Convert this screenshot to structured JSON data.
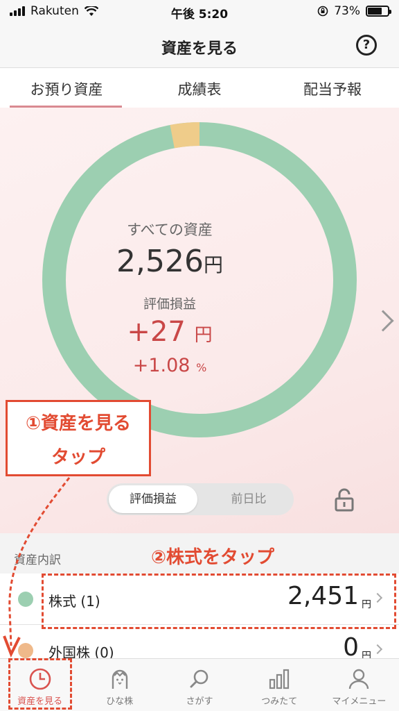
{
  "status_bar": {
    "carrier": "Rakuten",
    "time": "午後 5:20",
    "battery": "73%",
    "battery_level": 0.73
  },
  "nav": {
    "title": "資産を見る",
    "help_icon": "?"
  },
  "tabs": [
    {
      "label": "お預り資産",
      "active": true
    },
    {
      "label": "成績表",
      "active": false
    },
    {
      "label": "配当予報",
      "active": false
    }
  ],
  "summary": {
    "all_label": "すべての資産",
    "total_value": "2,526",
    "total_unit": "円",
    "pl_label": "評価損益",
    "pl_value": "+27",
    "pl_unit": "円",
    "pl_pct": "+1.08",
    "pl_pct_unit": "%"
  },
  "donut": {
    "colors": {
      "stock": "#9ccfb1",
      "other": "#efcc8a"
    },
    "share_stock": 0.97,
    "share_other": 0.03
  },
  "toggle": {
    "active": "評価損益",
    "inactive": "前日比"
  },
  "breakdown": {
    "header": "資産内訳",
    "rows": [
      {
        "label": "株式 (1)",
        "value": "2,451",
        "unit": "円",
        "color": "#9ccfb1"
      },
      {
        "label": "外国株 (0)",
        "value": "0",
        "unit": "円",
        "color": "#efb98a"
      }
    ]
  },
  "bottom_tabs": [
    {
      "label": "資産を見る",
      "icon": "clock-pie-icon",
      "active": true
    },
    {
      "label": "ひな株",
      "icon": "chick-icon",
      "active": false
    },
    {
      "label": "さがす",
      "icon": "search-icon",
      "active": false
    },
    {
      "label": "つみたて",
      "icon": "bar-chart-icon",
      "active": false
    },
    {
      "label": "マイメニュー",
      "icon": "person-icon",
      "active": false
    }
  ],
  "annotations": {
    "step1_line1": "①資産を見る",
    "step1_line2": "タップ",
    "step2": "②株式をタップ"
  },
  "accent_color": "#e24b32"
}
